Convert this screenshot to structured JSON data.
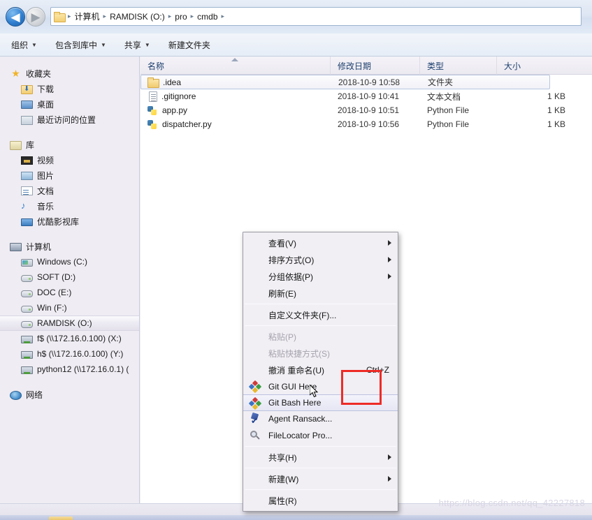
{
  "address_bar": {
    "back_button": "back-arrow",
    "forward_button": "forward-arrow",
    "history_dropdown": "chevron-down-icon",
    "breadcrumbs": [
      "计算机",
      "RAMDISK (O:)",
      "pro",
      "cmdb"
    ],
    "separator": "▸"
  },
  "command_bar": {
    "items": [
      {
        "label": "组织",
        "has_caret": true
      },
      {
        "label": "包含到库中",
        "has_caret": true
      },
      {
        "label": "共享",
        "has_caret": true
      },
      {
        "label": "新建文件夹",
        "has_caret": false
      }
    ],
    "caret": "▼"
  },
  "nav_pane": {
    "groups": [
      {
        "header": {
          "label": "收藏夹",
          "icon": "star-icon"
        },
        "items": [
          {
            "label": "下载",
            "icon": "download-folder-icon"
          },
          {
            "label": "桌面",
            "icon": "desktop-icon"
          },
          {
            "label": "最近访问的位置",
            "icon": "recent-places-icon"
          }
        ]
      },
      {
        "header": {
          "label": "库",
          "icon": "library-icon"
        },
        "items": [
          {
            "label": "视频",
            "icon": "video-icon"
          },
          {
            "label": "图片",
            "icon": "picture-icon"
          },
          {
            "label": "文档",
            "icon": "document-icon"
          },
          {
            "label": "音乐",
            "icon": "music-icon"
          },
          {
            "label": "优酷影视库",
            "icon": "youku-library-icon"
          }
        ]
      },
      {
        "header": {
          "label": "计算机",
          "icon": "computer-icon"
        },
        "items": [
          {
            "label": "Windows (C:)",
            "icon": "system-drive-icon",
            "selected": false
          },
          {
            "label": "SOFT (D:)",
            "icon": "drive-icon",
            "selected": false
          },
          {
            "label": "DOC (E:)",
            "icon": "drive-icon",
            "selected": false
          },
          {
            "label": "Win (F:)",
            "icon": "drive-icon",
            "selected": false
          },
          {
            "label": "RAMDISK (O:)",
            "icon": "drive-icon",
            "selected": true
          },
          {
            "label": "f$ (\\\\172.16.0.100) (X:)",
            "icon": "network-drive-icon",
            "selected": false
          },
          {
            "label": "h$ (\\\\172.16.0.100) (Y:)",
            "icon": "network-drive-icon",
            "selected": false
          },
          {
            "label": "python12 (\\\\172.16.0.1) (",
            "icon": "network-drive-icon",
            "selected": false
          }
        ]
      },
      {
        "header": {
          "label": "网络",
          "icon": "network-icon"
        },
        "items": []
      }
    ]
  },
  "file_list": {
    "columns": [
      {
        "key": "name",
        "label": "名称",
        "sorted": true,
        "sort_direction": "asc"
      },
      {
        "key": "date",
        "label": "修改日期",
        "sorted": false
      },
      {
        "key": "type",
        "label": "类型",
        "sorted": false
      },
      {
        "key": "size",
        "label": "大小",
        "sorted": false
      }
    ],
    "rows": [
      {
        "name": ".idea",
        "date": "2018-10-9 10:58",
        "type": "文件夹",
        "size": "",
        "icon": "folder-icon",
        "selected": true
      },
      {
        "name": ".gitignore",
        "date": "2018-10-9 10:41",
        "type": "文本文档",
        "size": "1 KB",
        "icon": "text-file-icon",
        "selected": false
      },
      {
        "name": "app.py",
        "date": "2018-10-9 10:51",
        "type": "Python File",
        "size": "1 KB",
        "icon": "python-file-icon",
        "selected": false
      },
      {
        "name": "dispatcher.py",
        "date": "2018-10-9 10:56",
        "type": "Python File",
        "size": "1 KB",
        "icon": "python-file-icon",
        "selected": false
      }
    ]
  },
  "context_menu": {
    "items": [
      {
        "label": "查看(V)",
        "icon": "",
        "submenu": true,
        "disabled": false,
        "shortcut": "",
        "highlighted": false,
        "separator_after": false
      },
      {
        "label": "排序方式(O)",
        "icon": "",
        "submenu": true,
        "disabled": false,
        "shortcut": "",
        "highlighted": false,
        "separator_after": false
      },
      {
        "label": "分组依据(P)",
        "icon": "",
        "submenu": true,
        "disabled": false,
        "shortcut": "",
        "highlighted": false,
        "separator_after": false
      },
      {
        "label": "刷新(E)",
        "icon": "",
        "submenu": false,
        "disabled": false,
        "shortcut": "",
        "highlighted": false,
        "separator_after": true
      },
      {
        "label": "自定义文件夹(F)...",
        "icon": "",
        "submenu": false,
        "disabled": false,
        "shortcut": "",
        "highlighted": false,
        "separator_after": true
      },
      {
        "label": "粘贴(P)",
        "icon": "",
        "submenu": false,
        "disabled": true,
        "shortcut": "",
        "highlighted": false,
        "separator_after": false
      },
      {
        "label": "粘贴快捷方式(S)",
        "icon": "",
        "submenu": false,
        "disabled": true,
        "shortcut": "",
        "highlighted": false,
        "separator_after": false
      },
      {
        "label": "撤消 重命名(U)",
        "icon": "",
        "submenu": false,
        "disabled": false,
        "shortcut": "Ctrl+Z",
        "highlighted": false,
        "separator_after": false
      },
      {
        "label": "Git GUI Here",
        "icon": "git-icon",
        "submenu": false,
        "disabled": false,
        "shortcut": "",
        "highlighted": false,
        "separator_after": false
      },
      {
        "label": "Git Bash Here",
        "icon": "git-icon",
        "submenu": false,
        "disabled": false,
        "shortcut": "",
        "highlighted": true,
        "separator_after": false
      },
      {
        "label": "Agent Ransack...",
        "icon": "agent-ransack-icon",
        "submenu": false,
        "disabled": false,
        "shortcut": "",
        "highlighted": false,
        "separator_after": false
      },
      {
        "label": "FileLocator Pro...",
        "icon": "filelocator-icon",
        "submenu": false,
        "disabled": false,
        "shortcut": "",
        "highlighted": false,
        "separator_after": true
      },
      {
        "label": "共享(H)",
        "icon": "",
        "submenu": true,
        "disabled": false,
        "shortcut": "",
        "highlighted": false,
        "separator_after": true
      },
      {
        "label": "新建(W)",
        "icon": "",
        "submenu": true,
        "disabled": false,
        "shortcut": "",
        "highlighted": false,
        "separator_after": true
      },
      {
        "label": "属性(R)",
        "icon": "",
        "submenu": false,
        "disabled": false,
        "shortcut": "",
        "highlighted": false,
        "separator_after": false
      }
    ]
  },
  "annotation": {
    "highlight_color": "#ee2b26"
  },
  "watermark": {
    "text": "https://blog.csdn.net/qq_42227818"
  }
}
